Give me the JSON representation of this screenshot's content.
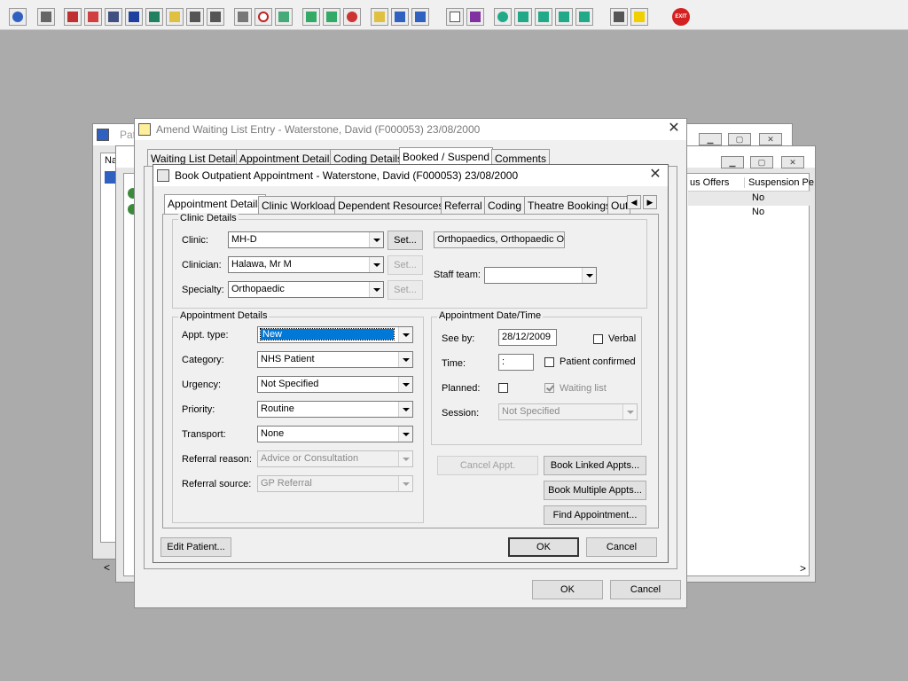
{
  "toolbar": {
    "exit_label": "EXIT"
  },
  "bg_window1": {
    "title_fragment": "Pat",
    "col_fragment": "Na"
  },
  "bg_window2": {
    "headers": [
      "us Offers",
      "Suspension Pe"
    ],
    "rows": [
      [
        "",
        "No"
      ],
      [
        "",
        "No"
      ]
    ]
  },
  "amend": {
    "title": "Amend Waiting List Entry - Waterstone, David (F000053) 23/08/2000",
    "tabs": [
      "Waiting List Details",
      "Appointment Details",
      "Coding Details",
      "Booked / Suspend",
      "Comments"
    ],
    "ok_label": "OK",
    "cancel_label": "Cancel"
  },
  "book": {
    "title": "Book Outpatient Appointment - Waterstone, David (F000053) 23/08/2000",
    "tabs": [
      "Appointment Details",
      "Clinic Workload",
      "Dependent Resources",
      "Referral",
      "Coding",
      "Theatre Bookings",
      "Out"
    ],
    "clinic_details": {
      "title": "Clinic Details",
      "clinic_label": "Clinic:",
      "clinic_value": "MH-D",
      "clinician_label": "Clinician:",
      "clinician_value": "Halawa, Mr M",
      "specialty_label": "Specialty:",
      "specialty_value": "Orthopaedic",
      "set_label": "Set...",
      "clinic_desc": "Orthopaedics, Orthopaedic OP",
      "staff_team_label": "Staff team:",
      "staff_team_value": ""
    },
    "appt_details": {
      "title": "Appointment Details",
      "appt_type_label": "Appt. type:",
      "appt_type_value": "New",
      "category_label": "Category:",
      "category_value": "NHS Patient",
      "urgency_label": "Urgency:",
      "urgency_value": "Not Specified",
      "priority_label": "Priority:",
      "priority_value": "Routine",
      "transport_label": "Transport:",
      "transport_value": "None",
      "ref_reason_label": "Referral reason:",
      "ref_reason_value": "Advice or Consultation",
      "ref_source_label": "Referral source:",
      "ref_source_value": "GP Referral"
    },
    "appt_datetime": {
      "title": "Appointment Date/Time",
      "see_by_label": "See by:",
      "see_by_value": "28/12/2009",
      "verbal_label": "Verbal",
      "time_label": "Time:",
      "time_value": ":",
      "patient_confirmed_label": "Patient confirmed",
      "planned_label": "Planned:",
      "waiting_list_label": "Waiting list",
      "session_label": "Session:",
      "session_value": "Not Specified"
    },
    "buttons": {
      "cancel_appt": "Cancel Appt.",
      "book_linked": "Book Linked Appts...",
      "book_multiple": "Book Multiple Appts...",
      "find_appointment": "Find Appointment...",
      "edit_patient": "Edit Patient...",
      "ok": "OK",
      "cancel": "Cancel"
    }
  }
}
